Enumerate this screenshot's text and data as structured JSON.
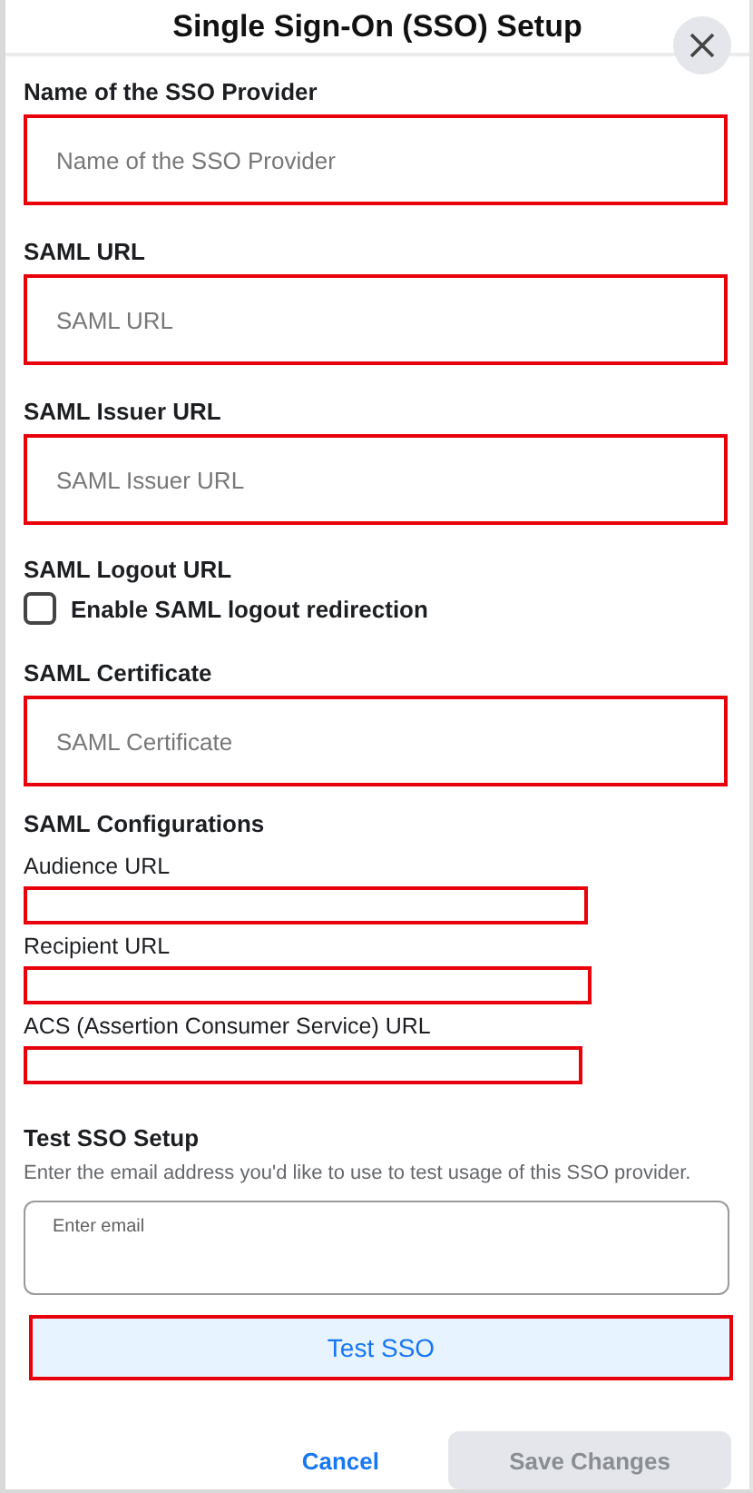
{
  "dialog": {
    "title": "Single Sign-On (SSO) Setup"
  },
  "fields": [
    {
      "label": "Name of the SSO Provider",
      "placeholder": "Name of the SSO Provider",
      "highlighted": true
    },
    {
      "label": "SAML URL",
      "placeholder": "SAML URL",
      "highlighted": true
    },
    {
      "label": "SAML Issuer URL",
      "placeholder": "SAML Issuer URL",
      "highlighted": true
    }
  ],
  "logout": {
    "label": "SAML Logout URL",
    "checkbox_label": "Enable SAML logout redirection",
    "checked": false
  },
  "certificate": {
    "label": "SAML Certificate",
    "placeholder": "SAML Certificate",
    "highlighted": true
  },
  "configurations": {
    "heading": "SAML Configurations",
    "items": [
      {
        "label": "Audience URL",
        "highlighted": true
      },
      {
        "label": "Recipient URL",
        "highlighted": true
      },
      {
        "label": "ACS (Assertion Consumer Service) URL",
        "highlighted": true
      }
    ]
  },
  "test": {
    "heading": "Test SSO Setup",
    "description": "Enter the email address you'd like to use to test usage of this SSO provider.",
    "placeholder": "Enter email",
    "button": "Test SSO",
    "highlighted": true
  },
  "footer": {
    "cancel": "Cancel",
    "save": "Save Changes",
    "save_disabled": true
  }
}
